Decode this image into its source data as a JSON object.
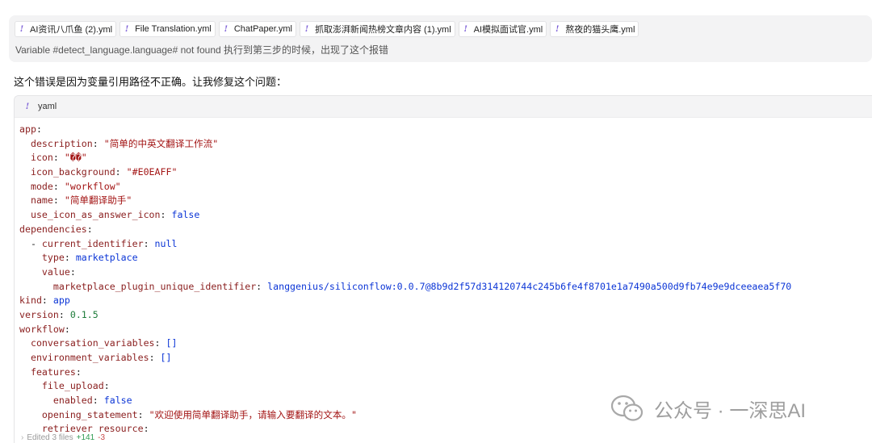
{
  "user_message": {
    "files": [
      "AI资讯八爪鱼 (2).yml",
      "File Translation.yml",
      "ChatPaper.yml",
      "抓取澎湃新闻热榜文章内容 (1).yml",
      "AI模拟面试官.yml",
      "熬夜的猫头鹰.yml"
    ],
    "file_icon": "yaml-exclamation-icon",
    "text": "Variable #detect_language.language# not found 执行到第三步的时候，出现了这个报错"
  },
  "assistant": {
    "intro": "这个错误是因为变量引用路径不正确。让我修复这个问题："
  },
  "code_block": {
    "language": "yaml",
    "lines": [
      [
        [
          "k",
          "app"
        ],
        [
          "p",
          ":"
        ]
      ],
      [
        [
          "p",
          "  "
        ],
        [
          "k",
          "description"
        ],
        [
          "p",
          ": "
        ],
        [
          "s",
          "\"简单的中英文翻译工作流\""
        ]
      ],
      [
        [
          "p",
          "  "
        ],
        [
          "k",
          "icon"
        ],
        [
          "p",
          ": "
        ],
        [
          "s",
          "\"��\""
        ]
      ],
      [
        [
          "p",
          "  "
        ],
        [
          "k",
          "icon_background"
        ],
        [
          "p",
          ": "
        ],
        [
          "s",
          "\"#E0EAFF\""
        ]
      ],
      [
        [
          "p",
          "  "
        ],
        [
          "k",
          "mode"
        ],
        [
          "p",
          ": "
        ],
        [
          "s",
          "\"workflow\""
        ]
      ],
      [
        [
          "p",
          "  "
        ],
        [
          "k",
          "name"
        ],
        [
          "p",
          ": "
        ],
        [
          "s",
          "\"简单翻译助手\""
        ]
      ],
      [
        [
          "p",
          "  "
        ],
        [
          "k",
          "use_icon_as_answer_icon"
        ],
        [
          "p",
          ": "
        ],
        [
          "b",
          "false"
        ]
      ],
      [
        [
          "k",
          "dependencies"
        ],
        [
          "p",
          ":"
        ]
      ],
      [
        [
          "p",
          "  - "
        ],
        [
          "k",
          "current_identifier"
        ],
        [
          "p",
          ": "
        ],
        [
          "b",
          "null"
        ]
      ],
      [
        [
          "p",
          "    "
        ],
        [
          "k",
          "type"
        ],
        [
          "p",
          ": "
        ],
        [
          "b",
          "marketplace"
        ]
      ],
      [
        [
          "p",
          "    "
        ],
        [
          "k",
          "value"
        ],
        [
          "p",
          ":"
        ]
      ],
      [
        [
          "p",
          "      "
        ],
        [
          "k",
          "marketplace_plugin_unique_identifier"
        ],
        [
          "p",
          ": "
        ],
        [
          "b",
          "langgenius/siliconflow:0.0.7@8b9d2f57d314120744c245b6fe4f8701e1a7490a500d9fb74e9e9dceeaea5f70"
        ]
      ],
      [
        [
          "k",
          "kind"
        ],
        [
          "p",
          ": "
        ],
        [
          "b",
          "app"
        ]
      ],
      [
        [
          "k",
          "version"
        ],
        [
          "p",
          ": "
        ],
        [
          "n",
          "0.1.5"
        ]
      ],
      [
        [
          "k",
          "workflow"
        ],
        [
          "p",
          ":"
        ]
      ],
      [
        [
          "p",
          "  "
        ],
        [
          "k",
          "conversation_variables"
        ],
        [
          "p",
          ": "
        ],
        [
          "b",
          "[]"
        ]
      ],
      [
        [
          "p",
          "  "
        ],
        [
          "k",
          "environment_variables"
        ],
        [
          "p",
          ": "
        ],
        [
          "b",
          "[]"
        ]
      ],
      [
        [
          "p",
          "  "
        ],
        [
          "k",
          "features"
        ],
        [
          "p",
          ":"
        ]
      ],
      [
        [
          "p",
          "    "
        ],
        [
          "k",
          "file_upload"
        ],
        [
          "p",
          ":"
        ]
      ],
      [
        [
          "p",
          "      "
        ],
        [
          "k",
          "enabled"
        ],
        [
          "p",
          ": "
        ],
        [
          "b",
          "false"
        ]
      ],
      [
        [
          "p",
          "    "
        ],
        [
          "k",
          "opening_statement"
        ],
        [
          "p",
          ": "
        ],
        [
          "s",
          "\"欢迎使用简单翻译助手，请输入要翻译的文本。\""
        ]
      ],
      [
        [
          "p",
          "    "
        ],
        [
          "k",
          "retriever_resource"
        ],
        [
          "p",
          ":"
        ]
      ]
    ]
  },
  "footer": {
    "label": "Edited 3 files",
    "added": "+141",
    "removed": "-3"
  },
  "watermark": {
    "text": "公众号 · 一深思AI",
    "icon": "wechat-icon"
  }
}
